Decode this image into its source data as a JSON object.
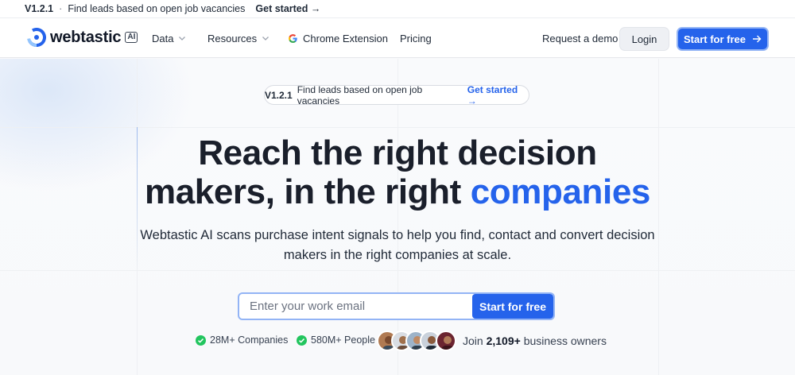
{
  "announcement": {
    "version": "V1.2.1",
    "text": "Find leads based on open job vacancies",
    "cta": "Get started →"
  },
  "nav": {
    "logo_text": "webtastic",
    "logo_badge": "AI",
    "items": [
      {
        "label": "Data",
        "has_dropdown": true
      },
      {
        "label": "Resources",
        "has_dropdown": true
      },
      {
        "label": "Chrome Extension",
        "icon": "google-icon"
      },
      {
        "label": "Pricing"
      }
    ],
    "request_demo": "Request a demo",
    "login": "Login",
    "start": "Start for free"
  },
  "hero": {
    "pill": {
      "version": "V1.2.1",
      "text": "Find leads based on open job vacancies",
      "cta": "Get started →"
    },
    "headline_line1": "Reach the right decision",
    "headline_line2_a": "makers, in the right",
    "headline_line2_b": "companies",
    "subtitle_line1": "Webtastic AI scans purchase intent signals to help you find, contact and convert decision",
    "subtitle_line2": "makers in the right companies at scale.",
    "email_placeholder": "Enter your work email",
    "submit": "Start for free",
    "stats": [
      {
        "label": "28M+ Companies",
        "icon": "check-circle-icon"
      },
      {
        "label": "580M+ People",
        "icon": "check-circle-icon"
      }
    ],
    "join_prefix": "Join",
    "join_count": "2,109+",
    "join_suffix": "business owners"
  },
  "colors": {
    "brand_blue": "#2563eb",
    "success_green": "#22c55e",
    "text_dark": "#1a1f2b"
  }
}
